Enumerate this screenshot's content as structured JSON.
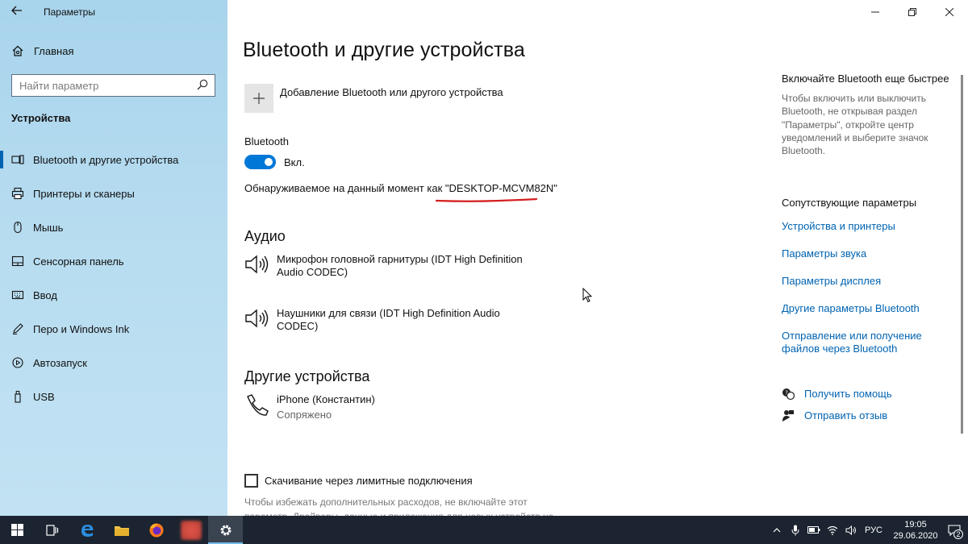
{
  "window": {
    "app_title": "Параметры",
    "minimize": "—",
    "restore": "❐",
    "close": "✕"
  },
  "sidebar": {
    "home_label": "Главная",
    "search_placeholder": "Найти параметр",
    "section_title": "Устройства",
    "items": [
      {
        "label": "Bluetooth и другие устройства",
        "icon": "bluetooth-devices-icon",
        "active": true
      },
      {
        "label": "Принтеры и сканеры",
        "icon": "printer-icon"
      },
      {
        "label": "Мышь",
        "icon": "mouse-icon"
      },
      {
        "label": "Сенсорная панель",
        "icon": "touchpad-icon"
      },
      {
        "label": "Ввод",
        "icon": "keyboard-icon"
      },
      {
        "label": "Перо и Windows Ink",
        "icon": "pen-icon"
      },
      {
        "label": "Автозапуск",
        "icon": "autoplay-icon"
      },
      {
        "label": "USB",
        "icon": "usb-icon"
      }
    ]
  },
  "main": {
    "title": "Bluetooth и другие устройства",
    "add_device_label": "Добавление Bluetooth или другого устройства",
    "bluetooth_label": "Bluetooth",
    "bluetooth_state": "Вкл.",
    "bluetooth_on": true,
    "discoverable_prefix": "Обнаруживаемое на данный момент как ",
    "device_name": "\"DESKTOP-MCVM82N\"",
    "audio_heading": "Аудио",
    "audio_devices": [
      {
        "name": "Микрофон головной гарнитуры (IDT High Definition Audio CODEC)"
      },
      {
        "name": "Наушники для связи (IDT High Definition Audio CODEC)"
      }
    ],
    "other_heading": "Другие устройства",
    "other_devices": [
      {
        "name": "iPhone (Константин)",
        "status": "Сопряжено"
      }
    ],
    "metered_label": "Скачивание через лимитные подключения",
    "metered_checked": false,
    "metered_desc": "Чтобы избежать дополнительных расходов, не включайте этот параметр. Драйверы, данные и приложения для новых устройств не"
  },
  "rail": {
    "faster_heading": "Включайте Bluetooth еще быстрее",
    "faster_text": "Чтобы включить или выключить Bluetooth, не открывая раздел \"Параметры\", откройте центр уведомлений и выберите значок Bluetooth.",
    "related_heading": "Сопутствующие параметры",
    "related_links": [
      "Устройства и принтеры",
      "Параметры звука",
      "Параметры дисплея",
      "Другие параметры Bluetooth",
      "Отправление или получение файлов через Bluetooth"
    ],
    "help_label": "Получить помощь",
    "feedback_label": "Отправить отзыв"
  },
  "taskbar": {
    "lang": "РУС",
    "time": "19:05",
    "date": "29.06.2020",
    "notifications": "2"
  },
  "colors": {
    "accent": "#0078d7",
    "link": "#0063b1",
    "underline": "#d42020",
    "taskbar": "#1b2430"
  }
}
